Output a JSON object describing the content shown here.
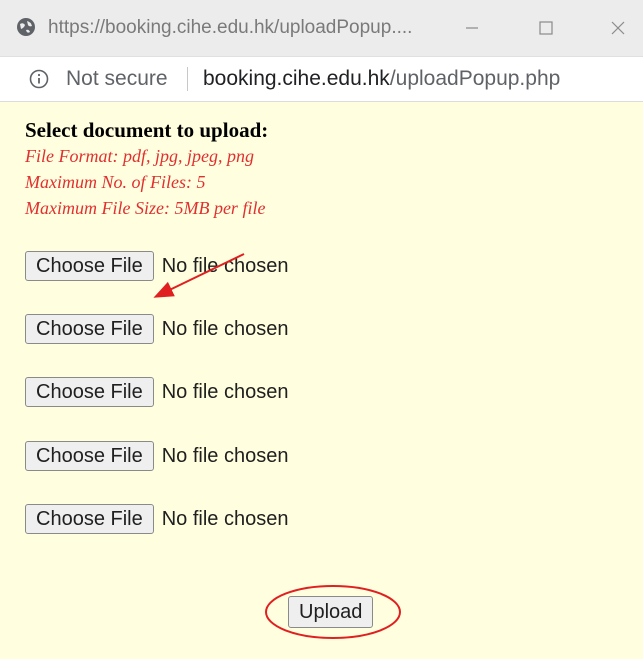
{
  "window": {
    "title": "https://booking.cihe.edu.hk/uploadPopup....",
    "minimize_icon": "minimize-icon",
    "maximize_icon": "maximize-icon",
    "close_icon": "close-icon"
  },
  "address_bar": {
    "security_label": "Not secure",
    "url_host": "booking.cihe.edu.hk",
    "url_path": "/uploadPopup.php"
  },
  "form": {
    "heading": "Select document to upload:",
    "notes": [
      "File Format: pdf, jpg, jpeg, png",
      "Maximum No. of Files: 5",
      "Maximum File Size: 5MB per file"
    ],
    "file_inputs": [
      {
        "button_label": "Choose File",
        "status": "No file chosen"
      },
      {
        "button_label": "Choose File",
        "status": "No file chosen"
      },
      {
        "button_label": "Choose File",
        "status": "No file chosen"
      },
      {
        "button_label": "Choose File",
        "status": "No file chosen"
      },
      {
        "button_label": "Choose File",
        "status": "No file chosen"
      }
    ],
    "upload_label": "Upload"
  },
  "colors": {
    "background": "#ffffe0",
    "note_text": "#e03030",
    "annotation": "#e02020"
  }
}
